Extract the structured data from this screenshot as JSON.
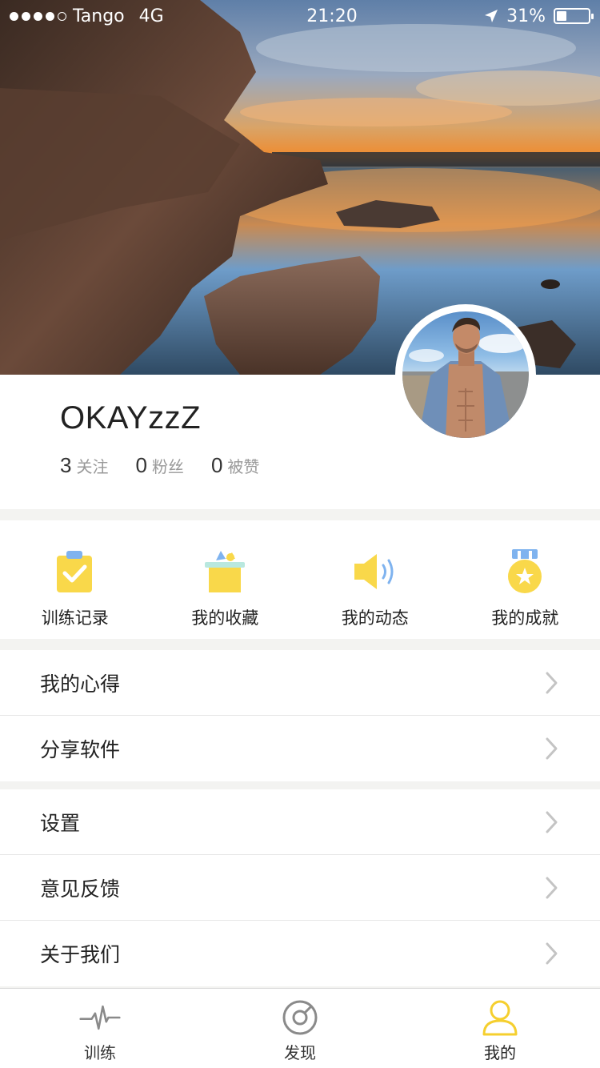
{
  "status_bar": {
    "carrier": "Tango",
    "network": "4G",
    "time": "21:20",
    "battery_percent": "31%",
    "signal_bars": 4
  },
  "profile": {
    "username": "OKAYzzZ",
    "stats": [
      {
        "value": "3",
        "label": "关注"
      },
      {
        "value": "0",
        "label": "粉丝"
      },
      {
        "value": "0",
        "label": "被赞"
      }
    ]
  },
  "quick_actions": [
    {
      "label": "训练记录",
      "icon": "clipboard-check-icon"
    },
    {
      "label": "我的收藏",
      "icon": "gift-box-icon"
    },
    {
      "label": "我的动态",
      "icon": "speaker-icon"
    },
    {
      "label": "我的成就",
      "icon": "medal-icon"
    }
  ],
  "menu_group_1": [
    {
      "label": "我的心得"
    },
    {
      "label": "分享软件"
    }
  ],
  "menu_group_2": [
    {
      "label": "设置"
    },
    {
      "label": "意见反馈"
    },
    {
      "label": "关于我们"
    }
  ],
  "tab_bar": {
    "tabs": [
      {
        "label": "训练",
        "icon": "pulse-icon"
      },
      {
        "label": "发现",
        "icon": "compass-icon"
      },
      {
        "label": "我的",
        "icon": "user-icon"
      }
    ],
    "active_index": 2
  },
  "colors": {
    "accent_yellow": "#f9d84a",
    "accent_blue": "#7fb3ef",
    "text_dark": "#222222",
    "text_muted": "#999999",
    "divider": "#f3f3f1"
  }
}
